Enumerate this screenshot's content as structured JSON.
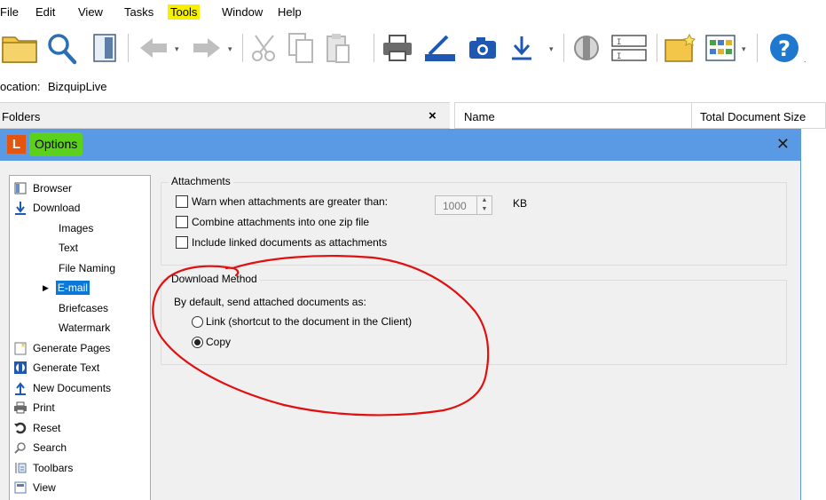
{
  "menu": {
    "file": "File",
    "edit": "Edit",
    "view": "View",
    "tasks": "Tasks",
    "tools": "Tools",
    "window": "Window",
    "help": "Help"
  },
  "toolbar": {
    "icons": [
      "folder-icon",
      "search-icon",
      "panel-icon",
      "back-arrow-icon",
      "forward-arrow-icon",
      "cut-icon",
      "copy-icon",
      "paste-icon",
      "print-icon",
      "scan-icon",
      "camera-icon",
      "download-icon",
      "generate-text-icon",
      "rename-icon",
      "new-folder-icon",
      "grid-view-icon",
      "help-icon"
    ]
  },
  "location": {
    "label": "ocation:",
    "value": "BizquipLive"
  },
  "folders_pane": {
    "title": "Folders",
    "close": "×"
  },
  "list_pane": {
    "col_name": "Name",
    "col_size": "Total Document Size"
  },
  "dialog": {
    "logo": "L",
    "title": "Options",
    "close": "✕",
    "tree": [
      {
        "label": "Browser",
        "icon": "browser-icon",
        "level": 0
      },
      {
        "label": "Download",
        "icon": "download-icon",
        "level": 0
      },
      {
        "label": "Images",
        "level": 1
      },
      {
        "label": "Text",
        "level": 1
      },
      {
        "label": "File Naming",
        "level": 1
      },
      {
        "label": "E-mail",
        "level": 1,
        "selected": true
      },
      {
        "label": "Briefcases",
        "level": 1
      },
      {
        "label": "Watermark",
        "level": 1
      },
      {
        "label": "Generate Pages",
        "icon": "generate-pages-icon",
        "level": 0
      },
      {
        "label": "Generate Text",
        "icon": "generate-text-icon",
        "level": 0
      },
      {
        "label": "New Documents",
        "icon": "new-documents-icon",
        "level": 0
      },
      {
        "label": "Print",
        "icon": "print-icon",
        "level": 0
      },
      {
        "label": "Reset",
        "icon": "reset-icon",
        "level": 0
      },
      {
        "label": "Search",
        "icon": "search-icon",
        "level": 0
      },
      {
        "label": "Toolbars",
        "icon": "toolbars-icon",
        "level": 0
      },
      {
        "label": "View",
        "icon": "view-icon",
        "level": 0
      }
    ],
    "attachments": {
      "title": "Attachments",
      "warn_label": "Warn when attachments are greater than:",
      "warn_checked": false,
      "size_value": "1000",
      "size_unit": "KB",
      "combine_label": "Combine attachments into one zip file",
      "combine_checked": false,
      "include_label": "Include linked documents as attachments",
      "include_checked": false
    },
    "download_method": {
      "title": "Download Method",
      "prompt": "By default, send attached documents as:",
      "option_link": "Link (shortcut to the document in the Client)",
      "option_copy": "Copy",
      "selected": "Copy"
    }
  },
  "colors": {
    "titlebar": "#5a9ae4",
    "title_highlight": "#5cd11c",
    "menu_highlight": "#f6f000",
    "annotation": "#e01010",
    "selection": "#0a78d7"
  }
}
